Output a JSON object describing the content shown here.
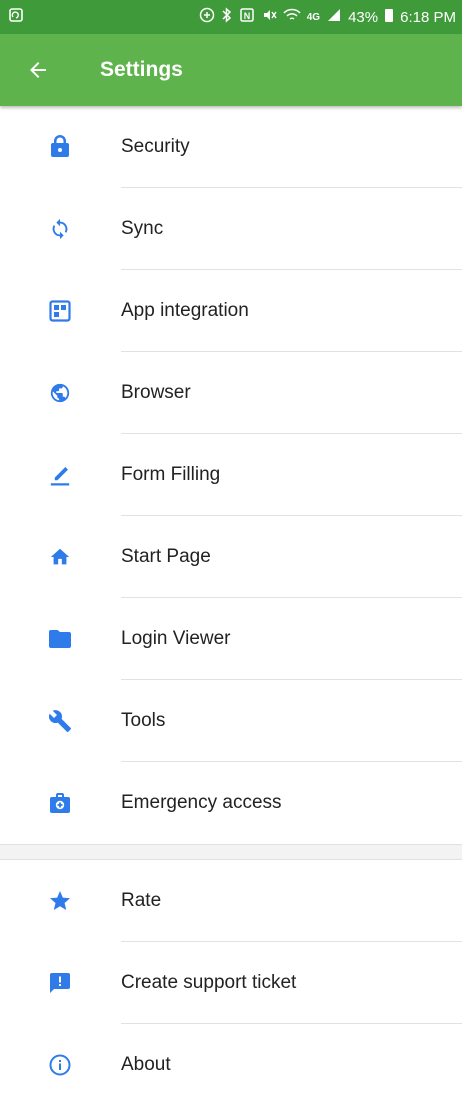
{
  "status_bar": {
    "battery": "43%",
    "time": "6:18 PM",
    "network": "4G"
  },
  "app_bar": {
    "title": "Settings"
  },
  "menu": {
    "items": [
      {
        "label": "Security",
        "icon": "lock-icon"
      },
      {
        "label": "Sync",
        "icon": "sync-icon"
      },
      {
        "label": "App integration",
        "icon": "app-integration-icon"
      },
      {
        "label": "Browser",
        "icon": "globe-icon"
      },
      {
        "label": "Form Filling",
        "icon": "pencil-icon"
      },
      {
        "label": "Start Page",
        "icon": "home-icon"
      },
      {
        "label": "Login Viewer",
        "icon": "folder-icon"
      },
      {
        "label": "Tools",
        "icon": "wrench-icon"
      },
      {
        "label": "Emergency access",
        "icon": "first-aid-icon"
      }
    ],
    "secondary": [
      {
        "label": "Rate",
        "icon": "star-icon"
      },
      {
        "label": "Create support ticket",
        "icon": "feedback-icon"
      },
      {
        "label": "About",
        "icon": "info-icon"
      }
    ]
  },
  "colors": {
    "app_bar": "#5fb34d",
    "status_bar": "#3f9a3a",
    "icon_accent": "#2f7bea"
  }
}
